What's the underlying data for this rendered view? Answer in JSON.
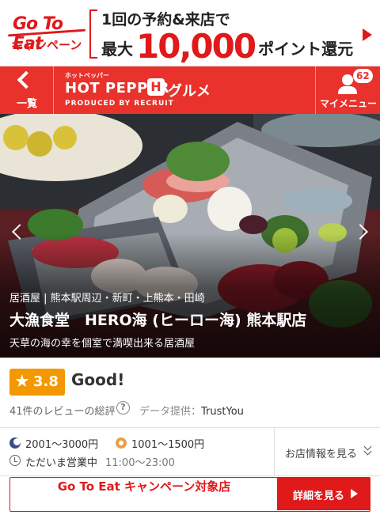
{
  "campaign": {
    "logo_line1": "Go To Eat",
    "logo_line2": "キャンペーン",
    "line1": "1回の予約&来店で",
    "line2_prefix": "最大",
    "line2_amount": "10,000",
    "line2_suffix": "ポイント還元"
  },
  "header": {
    "back_label": "一覧",
    "logo_kana": "ホットペッパー",
    "logo_name": "HOT PEPPER",
    "logo_sub": "グルメ",
    "logo_produced": "PRODUCED BY RECRUIT",
    "mymenu_label": "マイメニュー",
    "mymenu_badge": "62"
  },
  "restaurant": {
    "area": "居酒屋 | 熊本駅周辺・新町・上熊本・田崎",
    "name": "大漁食堂　HERO海 (ヒーロー海) 熊本駅店",
    "catch": "天草の海の幸を個室で満喫出来る居酒屋"
  },
  "rating": {
    "score": "3.8",
    "word": "Good!",
    "reviews": "41件のレビューの総評",
    "help_glyph": "?",
    "provider_label": "データ提供：",
    "provider": "TrustYou"
  },
  "info": {
    "dinner_budget": "2001～3000円",
    "lunch_budget": "1001～1500円",
    "status": "ただいま営業中",
    "hours": "11:00～23:00",
    "more_label": "お店情報を見る"
  },
  "gte_bar": {
    "label": "Go To Eat キャンペーン対象店",
    "detail_label": "詳細を見る"
  },
  "colors": {
    "brand_red": "#e8322b",
    "accent_red": "#e0191b",
    "star_orange": "#f39800"
  }
}
